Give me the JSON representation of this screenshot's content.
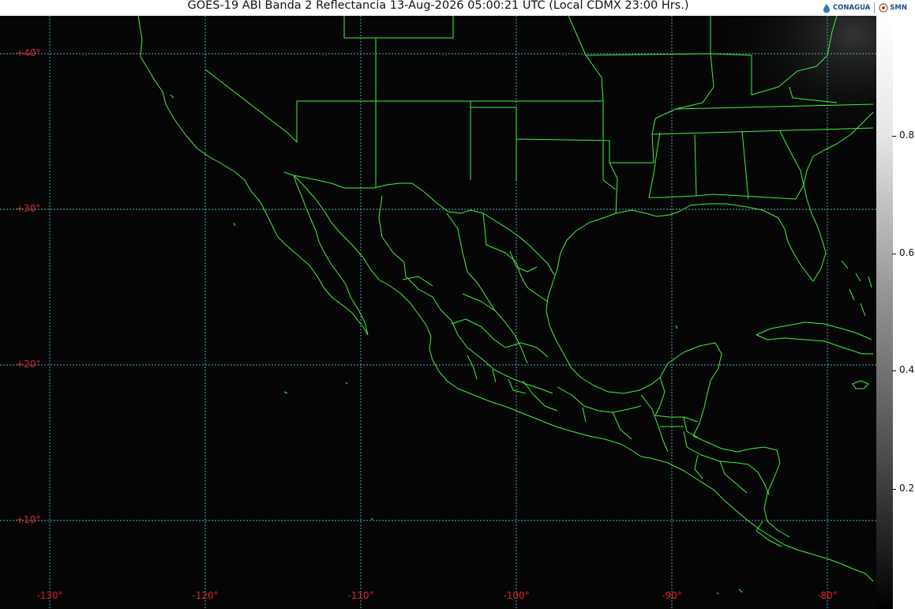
{
  "header": {
    "title": "GOES-19 ABI Banda 2 Reflectancia 13-Aug-2026 05:00:21 UTC (Local CDMX  23:00 Hrs.)",
    "logo_conagua": "CONAGUA",
    "logo_smn": "SMN"
  },
  "map": {
    "lat_labels": [
      "+40°",
      "+30°",
      "+20°",
      "+10°"
    ],
    "lon_labels": [
      "-130°",
      "-120°",
      "-110°",
      "-100°",
      "-90°",
      "-80°"
    ],
    "colors": {
      "borders": "#3ef23e",
      "grid": "#4fb8c8",
      "grid_labels": "#e0202a",
      "background": "#050505"
    }
  },
  "colorbar": {
    "labels": [
      "0.8",
      "0.6",
      "0.4",
      "0.2"
    ],
    "values": [
      0.8,
      0.6,
      0.4,
      0.2
    ]
  }
}
